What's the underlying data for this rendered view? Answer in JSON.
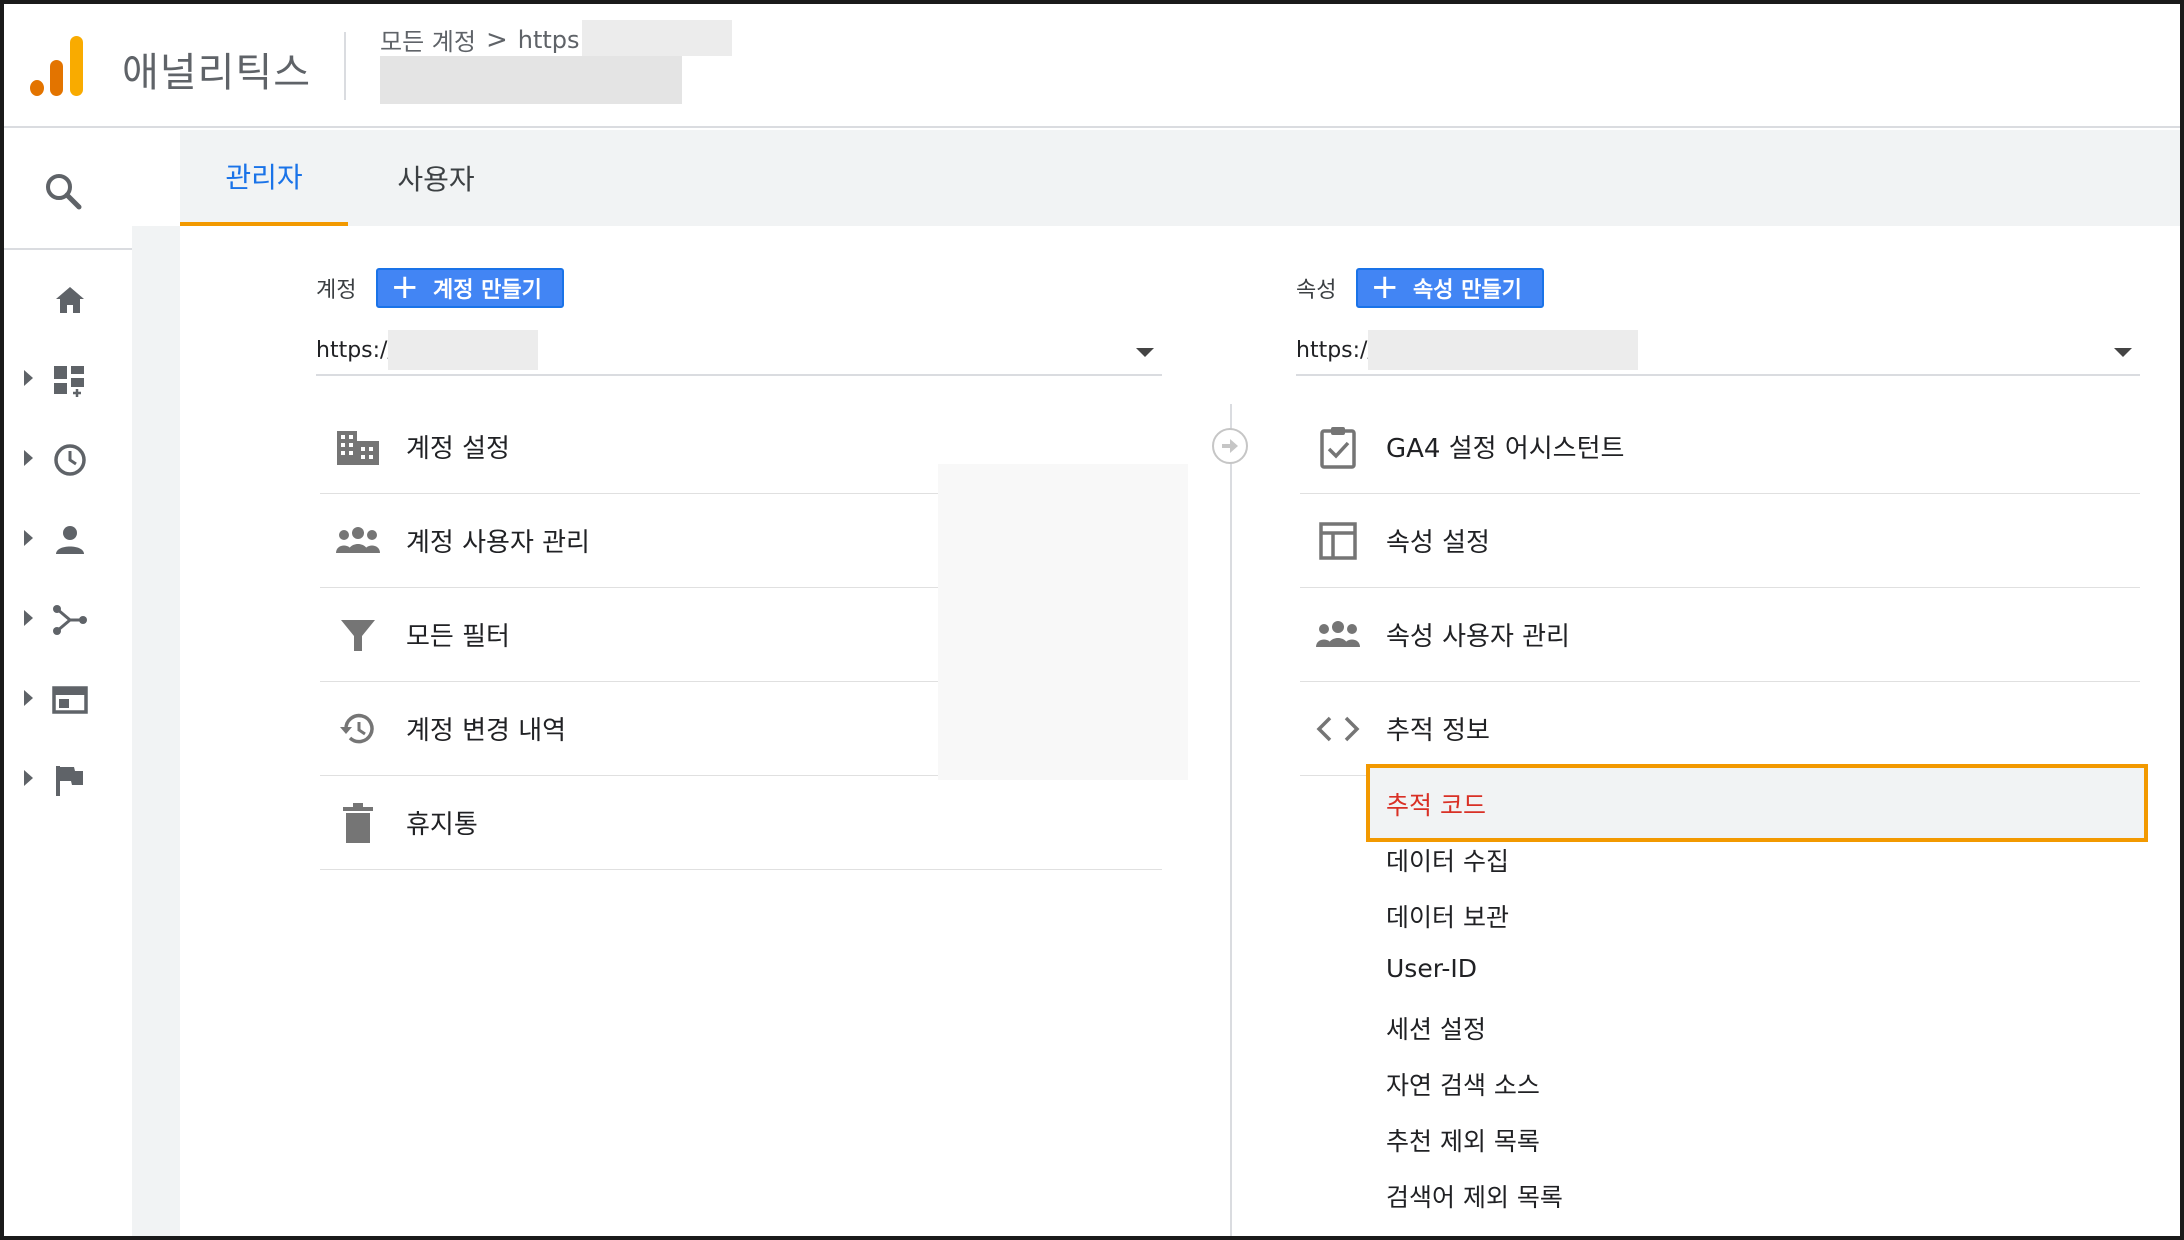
{
  "header": {
    "app_title": "애널리틱스",
    "breadcrumb_root": "모든 계정",
    "breadcrumb_chevron": ">",
    "breadcrumb_url": "https://"
  },
  "tabs": [
    {
      "label": "관리자",
      "active": true
    },
    {
      "label": "사용자",
      "active": false
    }
  ],
  "account": {
    "label": "계정",
    "create_button": "계정 만들기",
    "selected": "https://",
    "menu": [
      {
        "icon": "building-icon",
        "label": "계정 설정"
      },
      {
        "icon": "people-icon",
        "label": "계정 사용자 관리"
      },
      {
        "icon": "filter-icon",
        "label": "모든 필터"
      },
      {
        "icon": "history-icon",
        "label": "계정 변경 내역"
      },
      {
        "icon": "trash-icon",
        "label": "휴지통"
      }
    ]
  },
  "property": {
    "label": "속성",
    "create_button": "속성 만들기",
    "selected": "https://",
    "menu": [
      {
        "icon": "clipboard-check-icon",
        "label": "GA4 설정 어시스턴트"
      },
      {
        "icon": "layout-icon",
        "label": "속성 설정"
      },
      {
        "icon": "people-icon",
        "label": "속성 사용자 관리"
      },
      {
        "icon": "code-icon",
        "label": "추적 정보"
      }
    ],
    "tracking_submenu": [
      {
        "label": "추적 코드",
        "active": true
      },
      {
        "label": "데이터 수집",
        "active": false
      },
      {
        "label": "데이터 보관",
        "active": false
      },
      {
        "label": "User-ID",
        "active": false
      },
      {
        "label": "세션 설정",
        "active": false
      },
      {
        "label": "자연 검색 소스",
        "active": false
      },
      {
        "label": "추천 제외 목록",
        "active": false
      },
      {
        "label": "검색어 제외 목록",
        "active": false
      }
    ]
  },
  "colors": {
    "accent_blue": "#1a73e8",
    "button_blue": "#4285f4",
    "highlight_orange": "#f29900",
    "active_red": "#d93025",
    "logo_orange_dark": "#e37400",
    "logo_orange_light": "#f9ab00"
  }
}
